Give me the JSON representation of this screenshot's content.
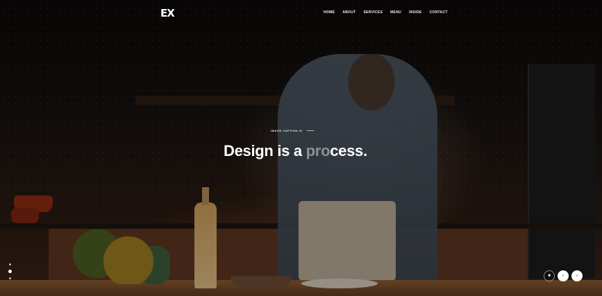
{
  "brand": {
    "logo": "EX"
  },
  "nav": {
    "items": [
      {
        "label": "HOME"
      },
      {
        "label": "ABOUT"
      },
      {
        "label": "SERVICES"
      },
      {
        "label": "MENU"
      },
      {
        "label": "INSIDE"
      },
      {
        "label": "CONTACT"
      }
    ]
  },
  "hero": {
    "caption": "IMAGE CAPTION #2",
    "headline_part1": "Design is a ",
    "headline_ghost": "pro",
    "headline_part2": "cess."
  },
  "slider": {
    "pagination_dots": 3,
    "active_dot": 2,
    "controls": [
      {
        "icon": "pause-icon",
        "glyph": "■"
      },
      {
        "icon": "arrow-left-icon",
        "glyph": "‹"
      },
      {
        "icon": "arrow-right-icon",
        "glyph": "›"
      }
    ]
  },
  "colors": {
    "accent": "#ffffff",
    "background": "#0d0a08"
  }
}
